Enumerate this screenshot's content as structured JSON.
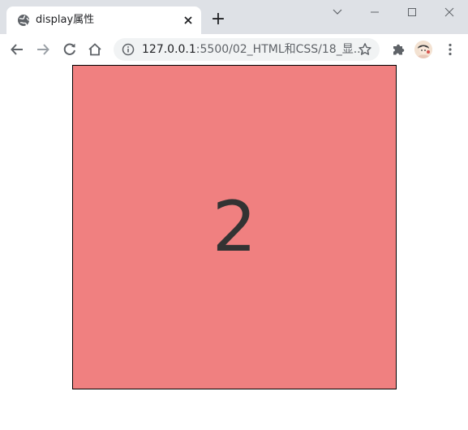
{
  "browser": {
    "tab": {
      "title": "display属性",
      "favicon": "globe-icon"
    },
    "new_tab_symbol": "+",
    "close_symbol": "✕",
    "window_controls": [
      "chevron-down-icon",
      "minimize-icon",
      "maximize-icon",
      "close-window-icon"
    ],
    "toolbar": {
      "back": "arrow-left-icon",
      "forward": "arrow-right-icon",
      "reload": "reload-icon",
      "home": "home-icon",
      "extensions": "puzzle-icon",
      "menu": "kebab-menu-icon"
    },
    "omnibox": {
      "host": "127.0.0.1",
      "path": ":5500/02_HTML和CSS/18_显...",
      "info_icon": "info-icon",
      "bookmark_icon": "star-icon"
    }
  },
  "page": {
    "box_text": "2",
    "box_color": "#f08080",
    "text_color": "#333333"
  }
}
